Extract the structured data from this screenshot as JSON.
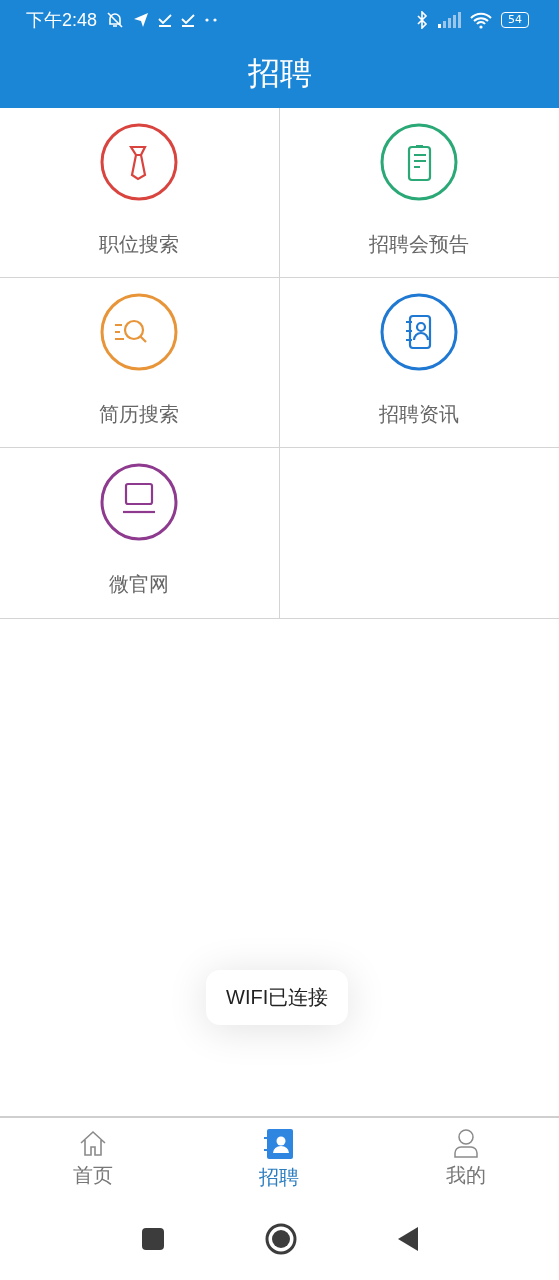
{
  "status_bar": {
    "time": "下午2:48",
    "battery": "54"
  },
  "header": {
    "title": "招聘"
  },
  "grid": [
    {
      "label": "职位搜索",
      "kind": "tie",
      "color": "#d9443f"
    },
    {
      "label": "招聘会预告",
      "kind": "clipboard",
      "color": "#2aa876"
    },
    {
      "label": "简历搜索",
      "kind": "search-list",
      "color": "#e8953a"
    },
    {
      "label": "招聘资讯",
      "kind": "contact-book",
      "color": "#1f78d1"
    },
    {
      "label": "微官网",
      "kind": "laptop",
      "color": "#8e3a8e"
    }
  ],
  "toast": {
    "text": "WIFI已连接"
  },
  "bottom_nav": [
    {
      "label": "首页",
      "kind": "home",
      "selected": false
    },
    {
      "label": "招聘",
      "kind": "contacts",
      "selected": true
    },
    {
      "label": "我的",
      "kind": "person",
      "selected": false
    }
  ]
}
